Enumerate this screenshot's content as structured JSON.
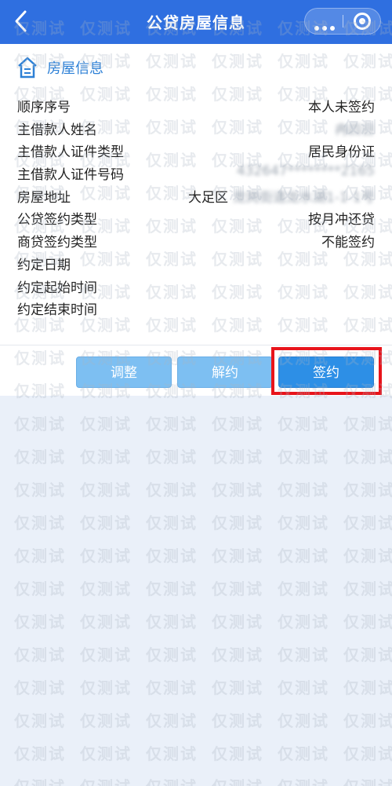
{
  "header": {
    "title": "公贷房屋信息",
    "back_icon": "chevron-left-icon",
    "more_icon": "more-dots-icon",
    "close_icon": "target-close-icon"
  },
  "section": {
    "icon": "home-icon",
    "title": "房屋信息"
  },
  "rows": [
    {
      "label": "顺序序号",
      "value": "本人未签约"
    },
    {
      "label": "主借款人姓名",
      "value": "冉四日",
      "blurred": true
    },
    {
      "label": "主借款人证件类型",
      "value": "居民身份证"
    },
    {
      "label": "主借款人证件号码",
      "value": "432647********2165",
      "blurred": true
    },
    {
      "label": "房屋地址",
      "district": "大足区",
      "value": "龙岗街道龙水湖1-1-1号"
    },
    {
      "label": "公贷签约类型",
      "value": "按月冲还贷"
    },
    {
      "label": "商贷签约类型",
      "value": "不能签约"
    },
    {
      "label": "约定日期",
      "value": ""
    },
    {
      "label": "约定起始时间",
      "value": ""
    },
    {
      "label": "约定结束时间",
      "value": ""
    }
  ],
  "buttons": {
    "adjust": "调整",
    "cancel": "解约",
    "sign": "签约"
  },
  "watermark_text": "仅测试",
  "colors": {
    "header_bg": "#2f6fe0",
    "accent": "#2d80d6",
    "primary_button": "#2d8fe6",
    "secondary_button": "#7dbff2",
    "highlight_box": "#e8141b",
    "page_bg": "#eaf0f9"
  }
}
